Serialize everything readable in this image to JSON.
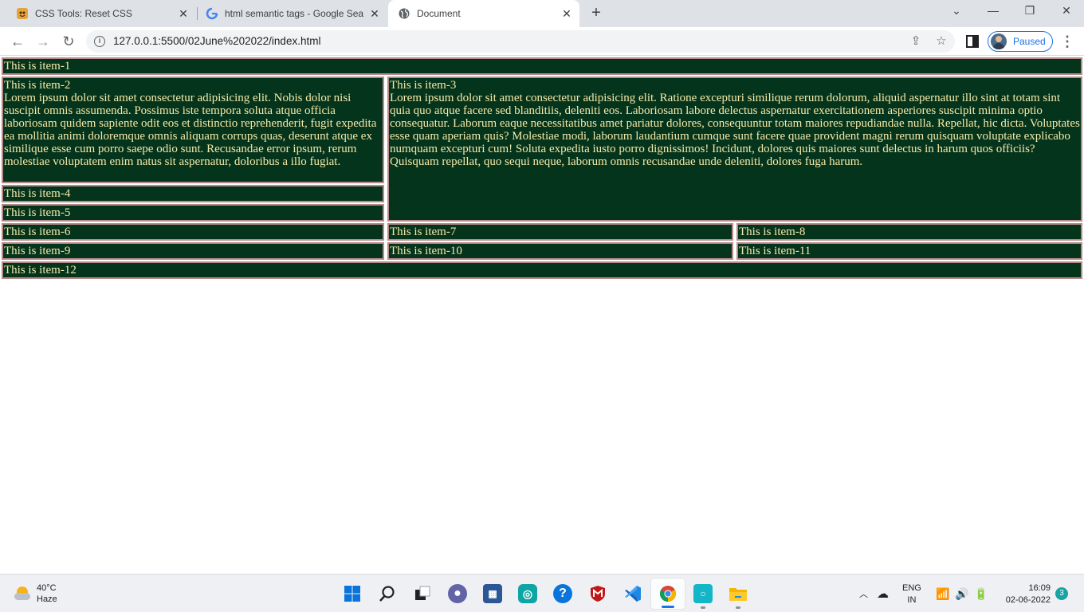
{
  "browser": {
    "tabs": [
      {
        "title": "CSS Tools: Reset CSS",
        "favicon": "css-tricks-icon",
        "active": false
      },
      {
        "title": "html semantic tags - Google Sea",
        "favicon": "google-icon",
        "active": false
      },
      {
        "title": "Document",
        "favicon": "globe-icon",
        "active": true
      }
    ],
    "new_tab_glyph": "+",
    "address": "127.0.0.1:5500/02June%202022/index.html",
    "profile_label": "Paused"
  },
  "page": {
    "items": [
      {
        "name": "This is item-1",
        "body": ""
      },
      {
        "name": "This is item-2",
        "body": "Lorem ipsum dolor sit amet consectetur adipisicing elit. Nobis dolor nisi suscipit omnis assumenda. Possimus iste tempora soluta atque officia laboriosam quidem sapiente odit eos et distinctio reprehenderit, fugit expedita ea mollitia animi doloremque omnis aliquam corrups quas, deserunt atque ex similique esse cum porro saepe odio sunt. Recusandae error ipsum, rerum molestiae voluptatem enim natus sit aspernatur, doloribus a illo fugiat."
      },
      {
        "name": "This is item-3",
        "body": "Lorem ipsum dolor sit amet consectetur adipisicing elit. Ratione excepturi similique rerum dolorum, aliquid aspernatur illo sint at totam sint quia quo atque facere sed blanditiis, deleniti eos. Laboriosam labore delectus aspernatur exercitationem asperiores suscipit minima optio consequatur. Laborum eaque necessitatibus amet pariatur dolores, consequuntur totam maiores repudiandae nulla. Repellat, hic dicta. Voluptates esse quam aperiam quis? Molestiae modi, laborum laudantium cumque sunt facere quae provident magni rerum quisquam voluptate explicabo numquam excepturi cum! Soluta expedita iusto porro dignissimos! Incidunt, dolores quis maiores sunt delectus in harum quos officiis? Quisquam repellat, quo sequi neque, laborum omnis recusandae unde deleniti, dolores fuga harum."
      },
      {
        "name": "This is item-4",
        "body": ""
      },
      {
        "name": "This is item-5",
        "body": ""
      },
      {
        "name": "This is item-6",
        "body": ""
      },
      {
        "name": "This is item-7",
        "body": ""
      },
      {
        "name": "This is item-8",
        "body": ""
      },
      {
        "name": "This is item-9",
        "body": ""
      },
      {
        "name": "This is item-10",
        "body": ""
      },
      {
        "name": "This is item-11",
        "body": ""
      },
      {
        "name": "This is item-12",
        "body": ""
      }
    ]
  },
  "taskbar": {
    "weather_temp": "40°C",
    "weather_desc": "Haze",
    "apps": [
      "windows-start-icon",
      "search-icon",
      "task-view-icon",
      "teams-chat-icon",
      "microsoft-store-icon",
      "edge-icon",
      "help-icon",
      "mcafee-icon",
      "vscode-icon",
      "chrome-icon",
      "app-icon",
      "file-explorer-icon"
    ],
    "lang_line1": "ENG",
    "lang_line2": "IN",
    "time": "16:09",
    "date": "02-06-2022",
    "notification_count": "3"
  },
  "colors": {
    "item_bg": "#05341c",
    "item_text": "#f5e9a8",
    "item_border": "#b78a8a",
    "accent": "#1a73e8"
  }
}
